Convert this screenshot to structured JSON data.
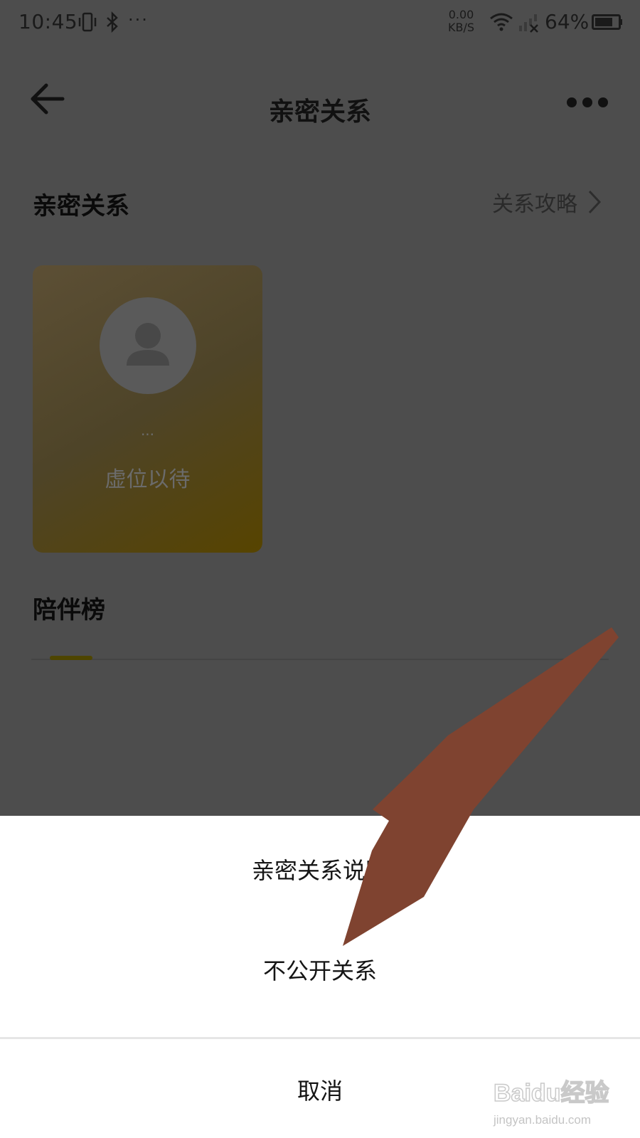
{
  "status_bar": {
    "time": "10:45",
    "more": "···",
    "net_speed_value": "0.00",
    "net_speed_unit": "KB/S",
    "battery_percent": "64%"
  },
  "nav": {
    "title": "亲密关系"
  },
  "section": {
    "title": "亲密关系",
    "guide_link": "关系攻略"
  },
  "card": {
    "dots": "...",
    "label": "虚位以待"
  },
  "companion": {
    "title": "陪伴榜"
  },
  "action_sheet": {
    "items": [
      "亲密关系说明",
      "不公开关系"
    ],
    "cancel": "取消"
  },
  "watermark": {
    "brand_text": "Baidu经验",
    "url": "jingyan.baidu.com"
  },
  "colors": {
    "overlay": "#4d4d4d",
    "sheet_bg": "#ffffff",
    "arrow": "#7f4330",
    "card_gradient_end": "#574400"
  }
}
